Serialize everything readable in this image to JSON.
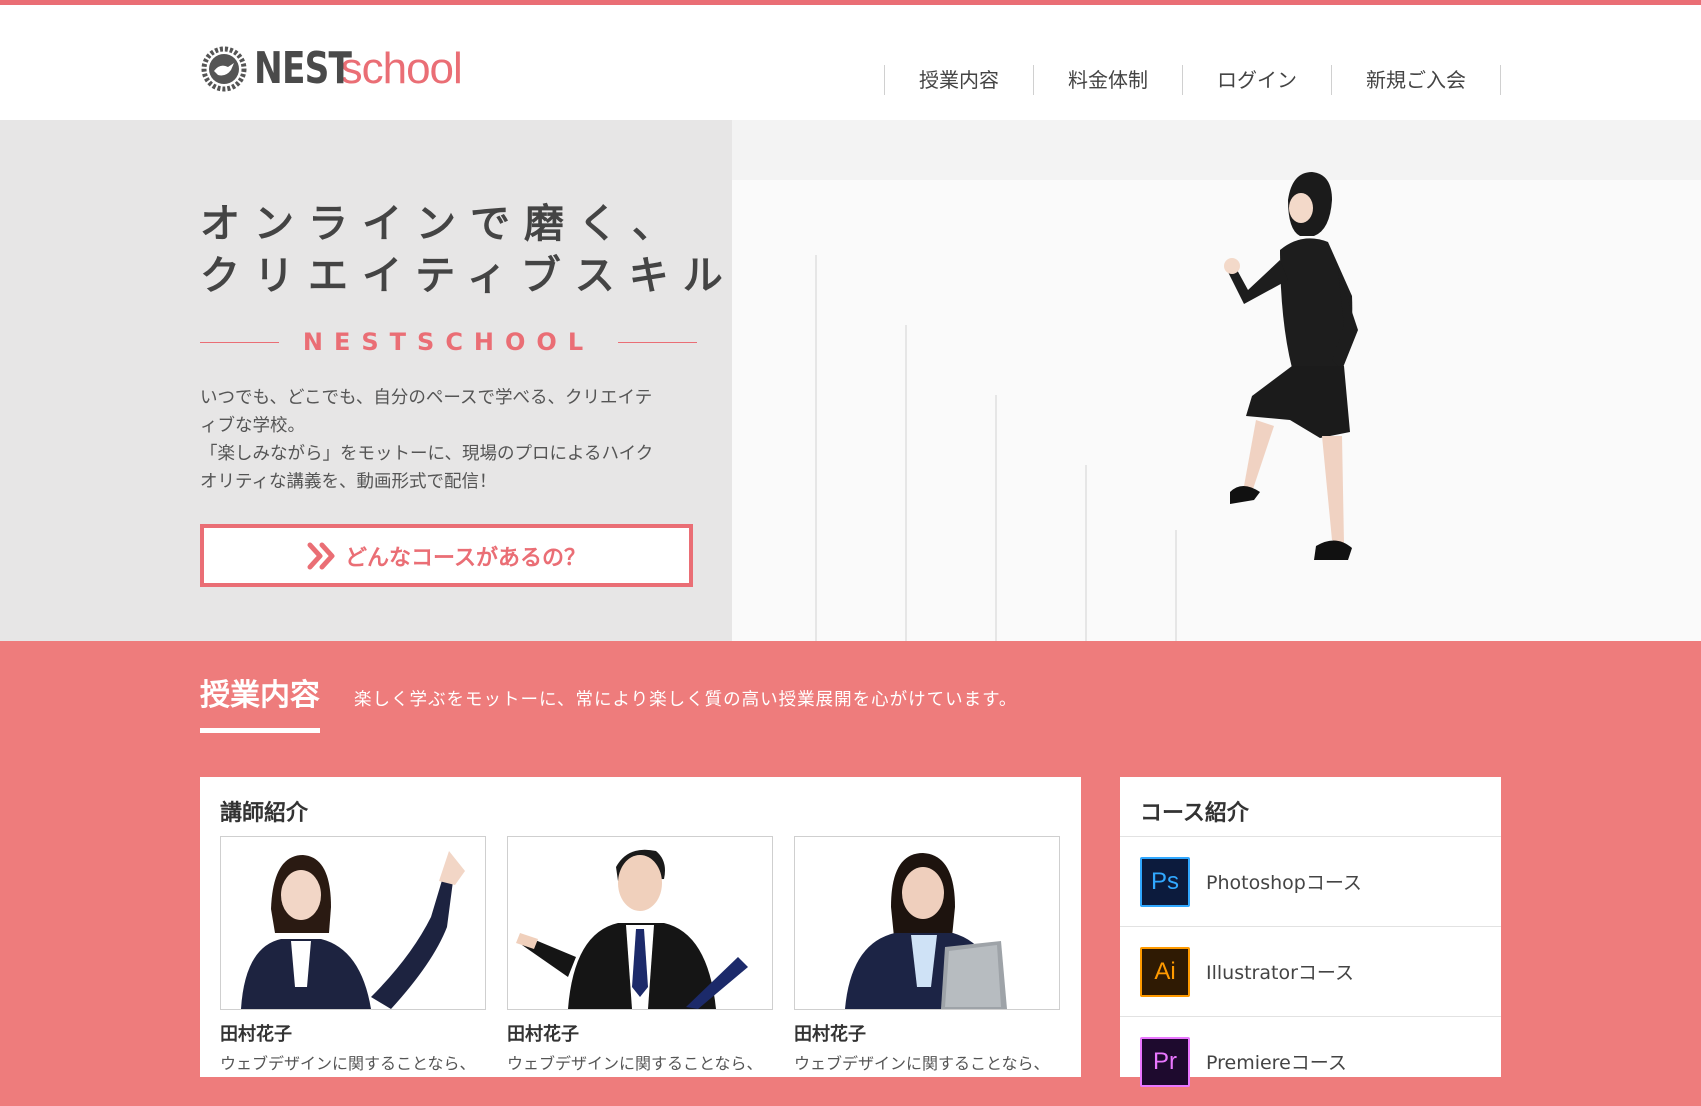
{
  "brand": {
    "name_a": "NEST",
    "name_b": "school"
  },
  "nav": [
    {
      "label": "授業内容"
    },
    {
      "label": "料金体制"
    },
    {
      "label": "ログイン"
    },
    {
      "label": "新規ご入会"
    }
  ],
  "hero": {
    "title_line1": "オンラインで磨く、",
    "title_line2": "クリエイティブスキル",
    "brand_word": "NESTSCHOOL",
    "desc_line1": "いつでも、どこでも、自分のペースで学べる、クリエイテ",
    "desc_line2": "ィブな学校。",
    "desc_line3": "「楽しみながら」をモットーに、現場のプロによるハイク",
    "desc_line4": "オリティな講義を、動画形式で配信！",
    "cta_label": "どんなコースがあるの？"
  },
  "section": {
    "title": "授業内容",
    "subtitle": "楽しく学ぶをモットーに、常により楽しく質の高い授業展開を心がけています。"
  },
  "instructors": {
    "title": "講師紹介",
    "items": [
      {
        "name": "田村花子",
        "desc": "ウェブデザインに関することなら、"
      },
      {
        "name": "田村花子",
        "desc": "ウェブデザインに関することなら、"
      },
      {
        "name": "田村花子",
        "desc": "ウェブデザインに関することなら、"
      }
    ]
  },
  "courses": {
    "title": "コース紹介",
    "items": [
      {
        "icon": "Ps",
        "label": "Photoshopコース",
        "bg": "#0c1b3d",
        "fg": "#31a8ff"
      },
      {
        "icon": "Ai",
        "label": "Illustratorコース",
        "bg": "#2f1a03",
        "fg": "#ff9a00"
      },
      {
        "icon": "Pr",
        "label": "Premiereコース",
        "bg": "#1e0a2e",
        "fg": "#ea77ff"
      }
    ]
  },
  "colors": {
    "accent": "#ea6e75",
    "section_bg": "#ee7c7c",
    "hero_bg": "#e7e6e6"
  }
}
